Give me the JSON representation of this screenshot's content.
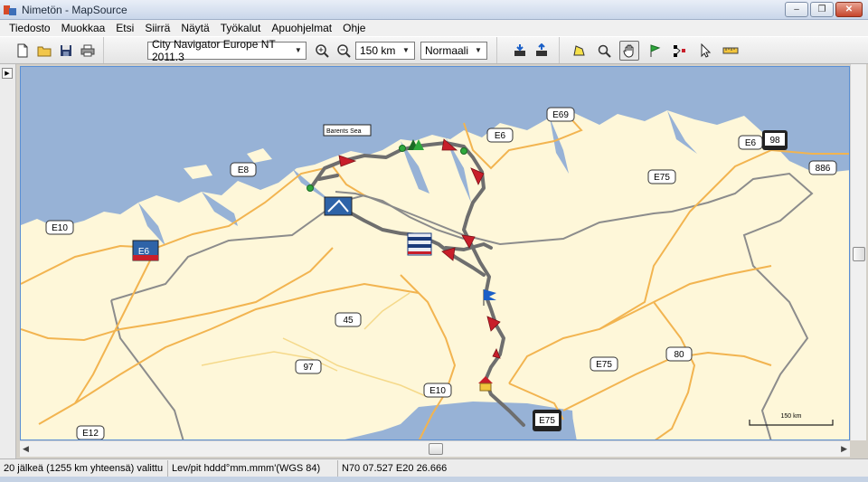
{
  "window": {
    "title": "Nimetön - MapSource",
    "min_label": "–",
    "max_label": "❐",
    "close_label": "✕"
  },
  "menu": [
    "Tiedosto",
    "Muokkaa",
    "Etsi",
    "Siirrä",
    "Näytä",
    "Työkalut",
    "Apuohjelmat",
    "Ohje"
  ],
  "toolbar": {
    "map_product": "City Navigator Europe NT 2011.3",
    "zoom_level": "150 km",
    "detail_level": "Normaali"
  },
  "map": {
    "sea_label": "Barents Sea",
    "scale_label": "150 km",
    "roads": {
      "e69": "E69",
      "e6_top": "E6",
      "e6_right": "E6",
      "r98": "98",
      "r886": "886",
      "e8": "E8",
      "e75_mid": "E75",
      "e10_left": "E10",
      "e6_left": "E6",
      "r45": "45",
      "r97": "97",
      "e10_low": "E10",
      "e75_low": "E75",
      "r80": "80",
      "e12": "E12",
      "e75_bottom": "E75"
    },
    "colors": {
      "sea": "#97b2d6",
      "land": "#fef7d9",
      "road_major": "#f2b450",
      "road_minor": "#f5d98a",
      "border": "#8c8c8c",
      "route": "#6e6e6e",
      "waypoint": "#c81e2a"
    }
  },
  "status": {
    "selection": "20 jälkeä (1255 km yhteensä) valittu",
    "position_format": "Lev/pit hddd°mm.mmm'(WGS 84)",
    "coords": "N70 07.527 E20 26.666"
  }
}
